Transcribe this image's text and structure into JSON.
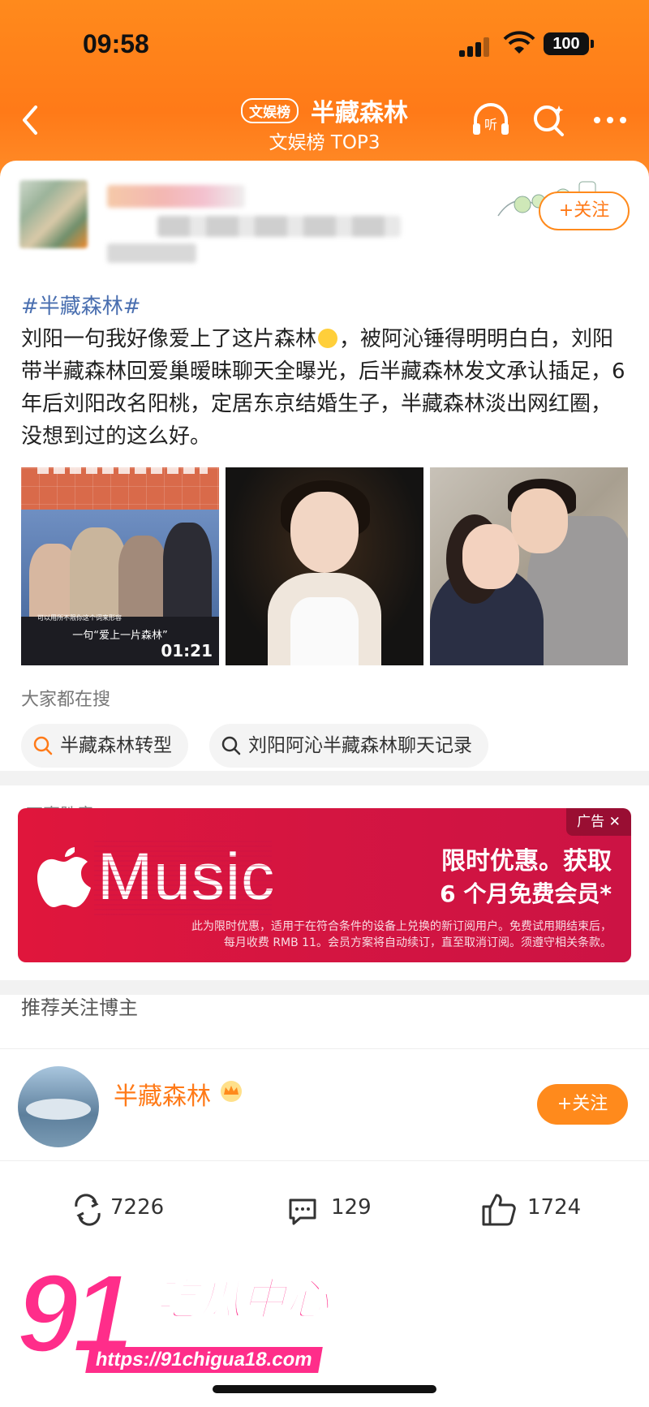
{
  "status_bar": {
    "time": "09:58",
    "battery": "100"
  },
  "nav": {
    "badge": "文娱榜",
    "title": "半藏森林",
    "subtitle": "文娱榜 TOP3",
    "listen_label": "听"
  },
  "post": {
    "follow_label": "+关注",
    "hashtag": "#半藏森林#",
    "text_before_emoji": "刘阳一句我好像爱上了这片森林",
    "text_after_emoji": "，被阿沁锤得明明白白，刘阳带半藏森林回爱巢暧昧聊天全曝光，后半藏森林发文承认插足，6年后刘阳改名阳桃，定居东京结婚生子，半藏森林淡出网红圈，没想到过的这么好。",
    "video_caption": "一句“爱上一片森林”",
    "video_small_caption": "可以用所不限你这个词来形容",
    "video_duration": "01:21"
  },
  "search": {
    "label": "大家都在搜",
    "chips": [
      "半藏森林转型",
      "刘阳阿沁半藏森林聊天记录"
    ]
  },
  "share": {
    "label": "万事胜意",
    "icons": [
      "weibo-repost-icon",
      "wechat-icon",
      "moments-icon",
      "qq-icon",
      "save-image-icon"
    ]
  },
  "ad": {
    "tag": "广告 ✕",
    "brand": "Music",
    "headline1": "限时优惠。获取",
    "headline2": "6 个月免费会员*",
    "fine_print1": "此为限时优惠，适用于在符合条件的设备上兑换的新订阅用户。免费试用期结束后，",
    "fine_print2": "每月收费 RMB 11。会员方案将自动续订，直至取消订阅。须遵守相关条款。"
  },
  "recommend": {
    "title": "推荐关注博主",
    "name": "半藏森林",
    "follow_label": "+关注"
  },
  "actions": {
    "repost_count": "7226",
    "comment_count": "129",
    "like_count": "1724"
  },
  "watermark": {
    "big": "91",
    "text": "吃瓜中心",
    "url": "https://91chigua18.com"
  },
  "colors": {
    "accent": "#ff7a18",
    "hashtag": "#4a6fb0",
    "ad_red": "#d41541",
    "watermark": "#ff2d8a"
  }
}
